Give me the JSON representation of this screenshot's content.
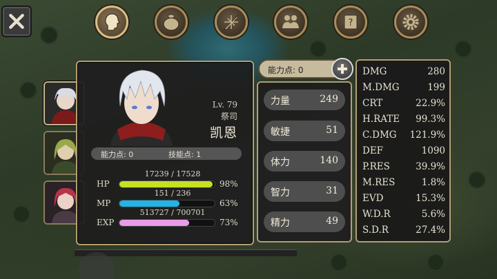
{
  "toolbar": {
    "tabs": [
      {
        "icon": "character-head-icon",
        "active": true
      },
      {
        "icon": "bag-icon",
        "active": false
      },
      {
        "icon": "skill-icon",
        "active": false
      },
      {
        "icon": "party-icon",
        "active": false
      },
      {
        "icon": "quest-scroll-icon",
        "active": false
      },
      {
        "icon": "gear-icon",
        "active": false
      }
    ]
  },
  "character": {
    "level": "Lv. 79",
    "job": "祭司",
    "name": "凯恩",
    "ability_points_label": "能力点: 0",
    "skill_points_label": "技能点: 1",
    "hp": {
      "label": "HP",
      "value": "17239 / 17528",
      "percent": "98%",
      "ratio": 0.98,
      "color": "#c6e024"
    },
    "mp": {
      "label": "MP",
      "value": "151 / 236",
      "percent": "63%",
      "ratio": 0.63,
      "color": "#21b4e6"
    },
    "exp": {
      "label": "EXP",
      "value": "513727 / 700701",
      "percent": "73%",
      "ratio": 0.73,
      "color": "#e99be8"
    }
  },
  "ability_header": {
    "label": "能力点: 0"
  },
  "attributes": [
    {
      "name": "力量",
      "value": "249"
    },
    {
      "name": "敏捷",
      "value": "51"
    },
    {
      "name": "体力",
      "value": "140"
    },
    {
      "name": "智力",
      "value": "31"
    },
    {
      "name": "精力",
      "value": "49"
    }
  ],
  "stats": [
    {
      "key": "DMG",
      "value": "280"
    },
    {
      "key": "M.DMG",
      "value": "199"
    },
    {
      "key": "CRT",
      "value": "22.9%"
    },
    {
      "key": "H.RATE",
      "value": "99.3%"
    },
    {
      "key": "C.DMG",
      "value": "121.9%"
    },
    {
      "key": "DEF",
      "value": "1090"
    },
    {
      "key": "P.RES",
      "value": "39.9%"
    },
    {
      "key": "M.RES",
      "value": "1.8%"
    },
    {
      "key": "EVD",
      "value": "15.3%"
    },
    {
      "key": "W.D.R",
      "value": "5.6%"
    },
    {
      "key": "S.D.R",
      "value": "27.4%"
    }
  ]
}
